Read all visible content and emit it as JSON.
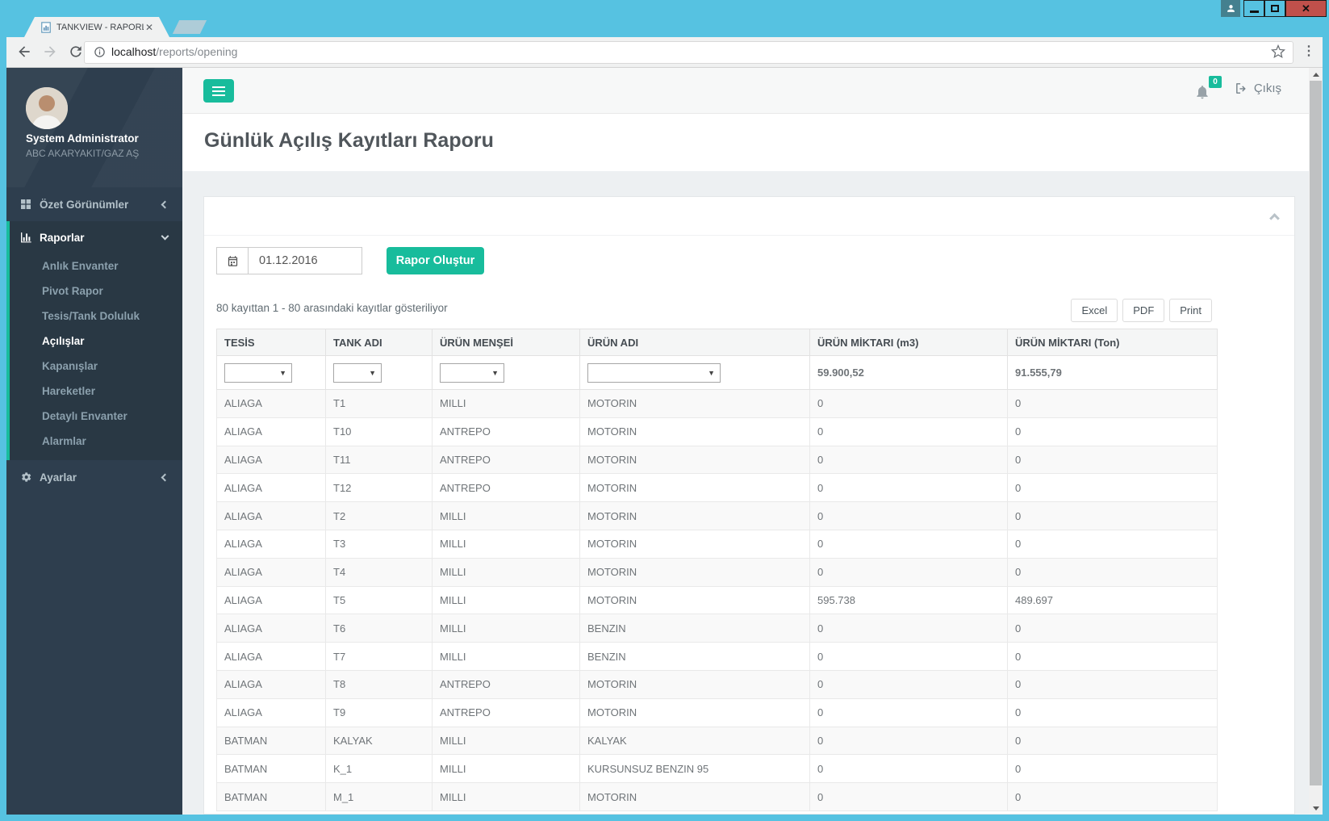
{
  "browser": {
    "tab_title": "TANKVIEW - RAPORLAR",
    "url_host": "localhost",
    "url_path": "/reports/opening"
  },
  "sidebar": {
    "user": {
      "name": "System Administrator",
      "org": "ABC AKARYAKIT/GAZ AŞ"
    },
    "sections": [
      {
        "label": "Özet Görünümler",
        "icon": "grid-icon",
        "state": "collapsed"
      },
      {
        "label": "Raporlar",
        "icon": "bar-chart-icon",
        "state": "expanded",
        "items": [
          "Anlık Envanter",
          "Pivot Rapor",
          "Tesis/Tank Doluluk",
          "Açılışlar",
          "Kapanışlar",
          "Hareketler",
          "Detaylı Envanter",
          "Alarmlar"
        ],
        "active_item": "Açılışlar"
      },
      {
        "label": "Ayarlar",
        "icon": "gear-icon",
        "state": "collapsed"
      }
    ]
  },
  "header": {
    "notification_count": "0",
    "logout_label": "Çıkış"
  },
  "page": {
    "title": "Günlük Açılış Kayıtları Raporu"
  },
  "report": {
    "date_value": "01.12.2016",
    "generate_label": "Rapor Oluştur",
    "records_info": "80 kayıttan 1 - 80 arasındaki kayıtlar gösteriliyor",
    "export_buttons": [
      "Excel",
      "PDF",
      "Print"
    ],
    "table": {
      "columns": [
        "TESİS",
        "TANK ADI",
        "ÜRÜN MENŞEİ",
        "ÜRÜN ADI",
        "ÜRÜN MİKTARI (m3)",
        "ÜRÜN MİKTARI (Ton)"
      ],
      "totals": {
        "m3": "59.900,52",
        "ton": "91.555,79"
      },
      "rows": [
        [
          "ALIAGA",
          "T1",
          "MILLI",
          "MOTORIN",
          "0",
          "0"
        ],
        [
          "ALIAGA",
          "T10",
          "ANTREPO",
          "MOTORIN",
          "0",
          "0"
        ],
        [
          "ALIAGA",
          "T11",
          "ANTREPO",
          "MOTORIN",
          "0",
          "0"
        ],
        [
          "ALIAGA",
          "T12",
          "ANTREPO",
          "MOTORIN",
          "0",
          "0"
        ],
        [
          "ALIAGA",
          "T2",
          "MILLI",
          "MOTORIN",
          "0",
          "0"
        ],
        [
          "ALIAGA",
          "T3",
          "MILLI",
          "MOTORIN",
          "0",
          "0"
        ],
        [
          "ALIAGA",
          "T4",
          "MILLI",
          "MOTORIN",
          "0",
          "0"
        ],
        [
          "ALIAGA",
          "T5",
          "MILLI",
          "MOTORIN",
          "595.738",
          "489.697"
        ],
        [
          "ALIAGA",
          "T6",
          "MILLI",
          "BENZIN",
          "0",
          "0"
        ],
        [
          "ALIAGA",
          "T7",
          "MILLI",
          "BENZIN",
          "0",
          "0"
        ],
        [
          "ALIAGA",
          "T8",
          "ANTREPO",
          "MOTORIN",
          "0",
          "0"
        ],
        [
          "ALIAGA",
          "T9",
          "ANTREPO",
          "MOTORIN",
          "0",
          "0"
        ],
        [
          "BATMAN",
          "KALYAK",
          "MILLI",
          "KALYAK",
          "0",
          "0"
        ],
        [
          "BATMAN",
          "K_1",
          "MILLI",
          "KURSUNSUZ BENZIN 95",
          "0",
          "0"
        ],
        [
          "BATMAN",
          "M_1",
          "MILLI",
          "MOTORIN",
          "0",
          "0"
        ]
      ]
    }
  },
  "colors": {
    "accent": "#18bc9c",
    "sidebar_bg": "#2e3e4e",
    "chrome_blue": "#56c2e1",
    "close_red": "#c0504b"
  }
}
